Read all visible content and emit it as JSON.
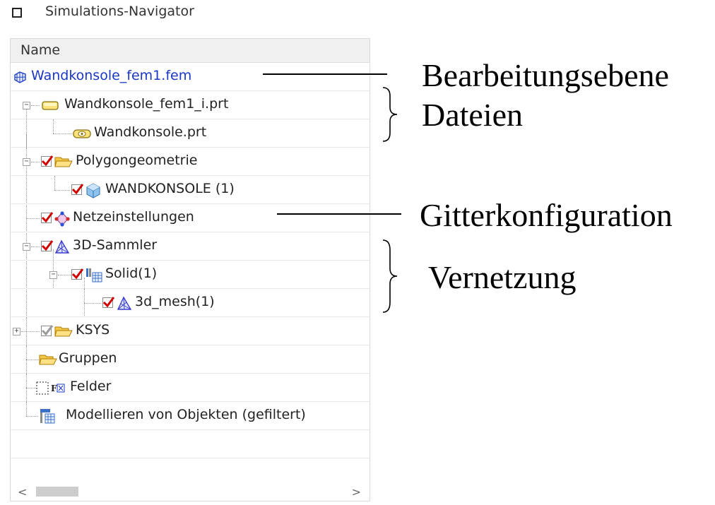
{
  "window": {
    "title": "Simulations-Navigator"
  },
  "table": {
    "column_header": "Name"
  },
  "tree": [
    {
      "label": "Wandkonsole_fem1.fem",
      "icon": "fem-mesh-icon"
    },
    {
      "label": "Wandkonsole_fem1_i.prt",
      "icon": "idealized-part-icon",
      "expander": "−"
    },
    {
      "label": "Wandkonsole.prt",
      "icon": "part-icon"
    },
    {
      "label": "Polygongeometrie",
      "icon": "folder-icon",
      "expander": "−",
      "checked": true
    },
    {
      "label": "WANDKONSOLE (1)",
      "icon": "body-icon",
      "checked": true
    },
    {
      "label": "Netzeinstellungen",
      "icon": "mesh-settings-icon",
      "checked": true
    },
    {
      "label": "3D-Sammler",
      "icon": "mesh-collector-icon",
      "expander": "−",
      "checked": true
    },
    {
      "label": "Solid(1)",
      "icon": "solid-icon",
      "expander": "−",
      "checked": true
    },
    {
      "label": "3d_mesh(1)",
      "icon": "mesh-collector-icon",
      "checked": true
    },
    {
      "label": "KSYS",
      "icon": "folder-icon",
      "expander": "+",
      "checked": true,
      "dimmed": true
    },
    {
      "label": "Gruppen",
      "icon": "folder-icon"
    },
    {
      "label": "Felder",
      "icon": "fields-icon"
    },
    {
      "label": "Modellieren von Objekten (gefiltert)",
      "icon": "modeling-objects-icon"
    }
  ],
  "scrollbar": {
    "left_arrow": "<",
    "right_arrow": ">"
  },
  "annotations": {
    "bearbeitungsebene": "Bearbeitungsebene",
    "dateien": "Dateien",
    "gitterkonfiguration": "Gitterkonfiguration",
    "vernetzung": "Vernetzung"
  },
  "colors": {
    "link_blue": "#1a37c4",
    "check_red": "#d00000",
    "folder_yellow": "#f3c74a"
  }
}
